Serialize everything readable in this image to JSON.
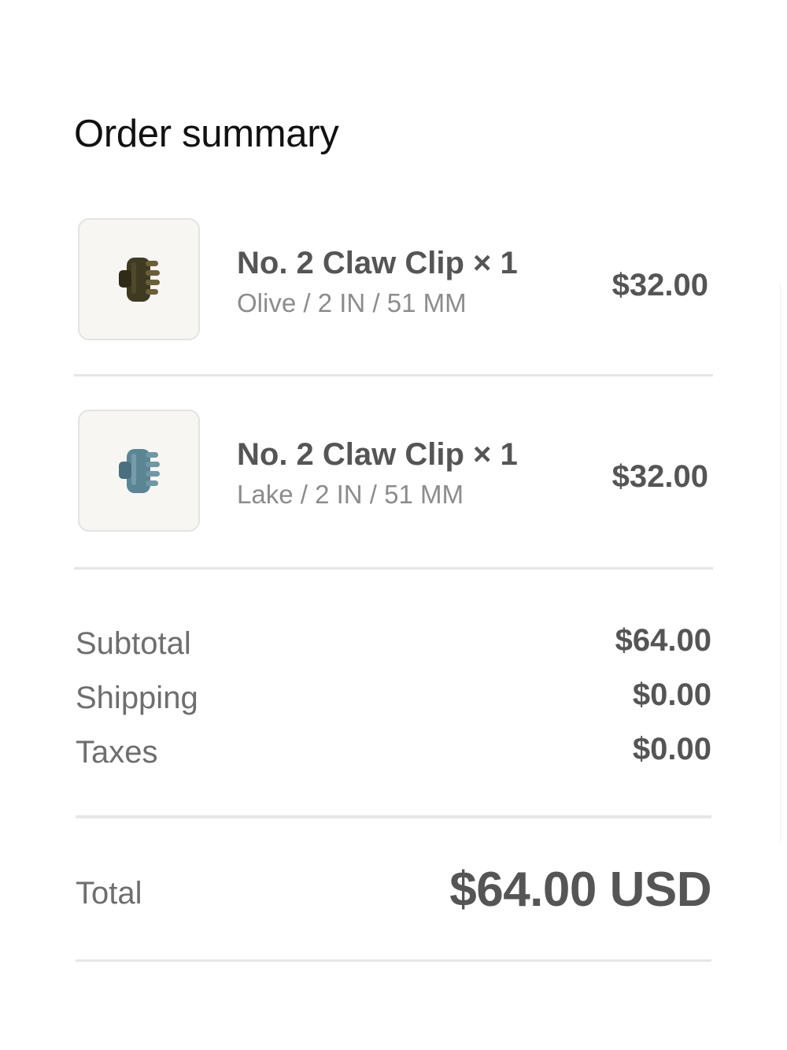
{
  "page": {
    "title": "Order summary"
  },
  "items": [
    {
      "name": "No. 2 Claw Clip × 1",
      "variant": "Olive / 2 IN / 51 MM",
      "price": "$32.00",
      "thumbnail_icon": "olive-claw-clip-image",
      "color": "#4a4326"
    },
    {
      "name": "No. 2 Claw Clip × 1",
      "variant": "Lake / 2 IN / 51 MM",
      "price": "$32.00",
      "thumbnail_icon": "lake-claw-clip-image",
      "color": "#5f8897"
    }
  ],
  "summary": {
    "subtotal_label": "Subtotal",
    "subtotal_value": "$64.00",
    "shipping_label": "Shipping",
    "shipping_value": "$0.00",
    "taxes_label": "Taxes",
    "taxes_value": "$0.00"
  },
  "total": {
    "label": "Total",
    "value": "$64.00 USD"
  },
  "colors": {
    "text_primary": "#555555",
    "text_muted": "#8c8c8c",
    "divider": "#e6e6e6"
  }
}
